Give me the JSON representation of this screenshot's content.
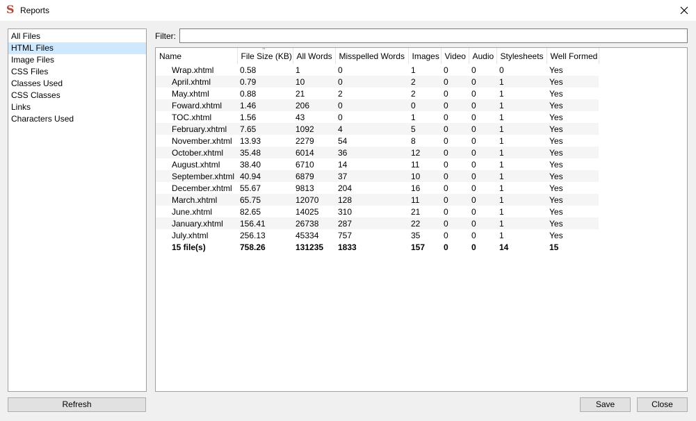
{
  "window": {
    "title": "Reports",
    "app_icon": "sigil-s-icon"
  },
  "sidebar": {
    "items": [
      {
        "label": "All Files"
      },
      {
        "label": "HTML Files",
        "selected": true
      },
      {
        "label": "Image Files"
      },
      {
        "label": "CSS Files"
      },
      {
        "label": "Classes Used"
      },
      {
        "label": "CSS Classes"
      },
      {
        "label": "Links"
      },
      {
        "label": "Characters Used"
      }
    ]
  },
  "filter": {
    "label": "Filter:",
    "value": ""
  },
  "table": {
    "columns": [
      "Name",
      "File Size (KB)",
      "All Words",
      "Misspelled Words",
      "Images",
      "Video",
      "Audio",
      "Stylesheets",
      "Well Formed"
    ],
    "sorted_column": "File Size (KB)",
    "rows": [
      [
        "Wrap.xhtml",
        "0.58",
        "1",
        "0",
        "1",
        "0",
        "0",
        "0",
        "Yes"
      ],
      [
        "April.xhtml",
        "0.79",
        "10",
        "0",
        "2",
        "0",
        "0",
        "1",
        "Yes"
      ],
      [
        "May.xhtml",
        "0.88",
        "21",
        "2",
        "2",
        "0",
        "0",
        "1",
        "Yes"
      ],
      [
        "Foward.xhtml",
        "1.46",
        "206",
        "0",
        "0",
        "0",
        "0",
        "1",
        "Yes"
      ],
      [
        "TOC.xhtml",
        "1.56",
        "43",
        "0",
        "1",
        "0",
        "0",
        "1",
        "Yes"
      ],
      [
        "February.xhtml",
        "7.65",
        "1092",
        "4",
        "5",
        "0",
        "0",
        "1",
        "Yes"
      ],
      [
        "November.xhtml",
        "13.93",
        "2279",
        "54",
        "8",
        "0",
        "0",
        "1",
        "Yes"
      ],
      [
        "October.xhtml",
        "35.48",
        "6014",
        "36",
        "12",
        "0",
        "0",
        "1",
        "Yes"
      ],
      [
        "August.xhtml",
        "38.40",
        "6710",
        "14",
        "11",
        "0",
        "0",
        "1",
        "Yes"
      ],
      [
        "September.xhtml",
        "40.94",
        "6879",
        "37",
        "10",
        "0",
        "0",
        "1",
        "Yes"
      ],
      [
        "December.xhtml",
        "55.67",
        "9813",
        "204",
        "16",
        "0",
        "0",
        "1",
        "Yes"
      ],
      [
        "March.xhtml",
        "65.75",
        "12070",
        "128",
        "11",
        "0",
        "0",
        "1",
        "Yes"
      ],
      [
        "June.xhtml",
        "82.65",
        "14025",
        "310",
        "21",
        "0",
        "0",
        "1",
        "Yes"
      ],
      [
        "January.xhtml",
        "156.41",
        "26738",
        "287",
        "22",
        "0",
        "0",
        "1",
        "Yes"
      ],
      [
        "July.xhtml",
        "256.13",
        "45334",
        "757",
        "35",
        "0",
        "0",
        "1",
        "Yes"
      ]
    ],
    "total": [
      "15 file(s)",
      "758.26",
      "131235",
      "1833",
      "157",
      "0",
      "0",
      "14",
      "15"
    ]
  },
  "buttons": {
    "refresh": "Refresh",
    "save": "Save",
    "close": "Close"
  },
  "colors": {
    "selection": "#cde8ff",
    "app_icon": "#b0463a",
    "window_bg": "#f0f0f0"
  }
}
